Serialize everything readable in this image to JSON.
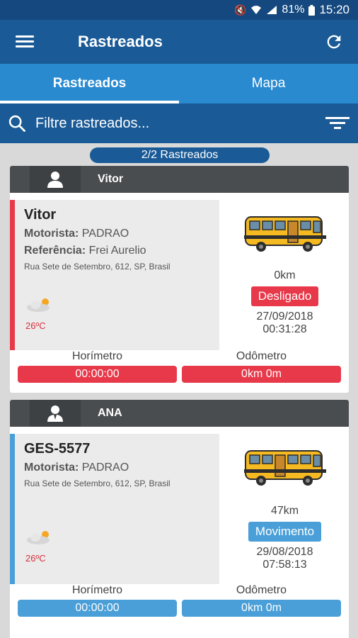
{
  "status_bar": {
    "battery": "81%",
    "time": "15:20"
  },
  "app_bar": {
    "title": "Rastreados"
  },
  "tabs": [
    {
      "label": "Rastreados",
      "active": true
    },
    {
      "label": "Mapa",
      "active": false
    }
  ],
  "search": {
    "placeholder": "Filtre rastreados..."
  },
  "count_label": "2/2 Rastreados",
  "colors": {
    "red": "#e8394a",
    "blue": "#4a9fd8",
    "header": "#1a5a96"
  },
  "cards": [
    {
      "header_name": "Vitor",
      "avatar_icon": "person-icon",
      "plate": "Vitor",
      "motorista_label": "Motorista:",
      "motorista_value": "PADRAO",
      "referencia_label": "Referência:",
      "referencia_value": "Frei Aurelio",
      "address": "Rua Sete de Setembro, 612, SP, Brasil",
      "temperature": "26ºC",
      "distance": "0km",
      "status": "Desligado",
      "date": "27/09/2018",
      "time": "00:31:28",
      "horimetro_label": "Horímetro",
      "horimetro_value": "00:00:00",
      "odometro_label": "Odômetro",
      "odometro_value": "0km 0m"
    },
    {
      "header_name": "ANA",
      "avatar_icon": "driver-icon",
      "plate": "GES-5577",
      "motorista_label": "Motorista:",
      "motorista_value": "PADRAO",
      "address": "Rua Sete de Setembro, 612, SP, Brasil",
      "temperature": "26ºC",
      "distance": "47km",
      "status": "Movimento",
      "date": "29/08/2018",
      "time": "07:58:13",
      "horimetro_label": "Horímetro",
      "horimetro_value": "00:00:00",
      "odometro_label": "Odômetro",
      "odometro_value": "0km 0m"
    }
  ]
}
